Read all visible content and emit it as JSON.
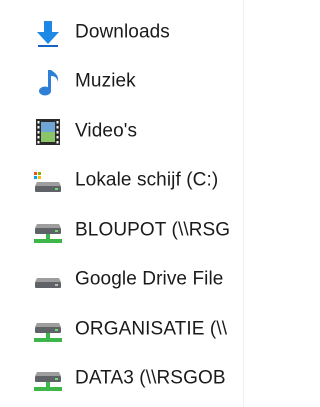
{
  "navigation_pane": {
    "items": [
      {
        "label": "Downloads",
        "icon": "downloads-arrow-icon"
      },
      {
        "label": "Muziek",
        "icon": "music-note-icon"
      },
      {
        "label": "Video's",
        "icon": "film-strip-icon"
      },
      {
        "label": "Lokale schijf (C:)",
        "icon": "local-disk-icon"
      },
      {
        "label": "BLOUPOT (\\\\RSG",
        "icon": "network-drive-icon"
      },
      {
        "label": "Google Drive File",
        "icon": "drive-icon"
      },
      {
        "label": "ORGANISATIE (\\\\",
        "icon": "network-drive-icon"
      },
      {
        "label": "DATA3 (\\\\RSGOB",
        "icon": "network-drive-icon"
      }
    ]
  },
  "colors": {
    "downloads_blue": "#1e88e5",
    "music_blue": "#2f7fd6",
    "network_green": "#3db64a",
    "drive_gray": "#5f6368"
  }
}
